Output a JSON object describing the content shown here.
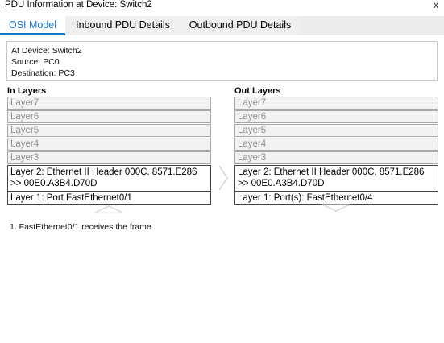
{
  "window": {
    "title": "PDU Information at Device: Switch2",
    "close_label": "x"
  },
  "tabs": [
    {
      "label": "OSI Model",
      "active": true
    },
    {
      "label": "Inbound PDU Details",
      "active": false
    },
    {
      "label": "Outbound PDU Details",
      "active": false
    }
  ],
  "info": {
    "device": "At Device: Switch2",
    "source": "Source: PC0",
    "destination": "Destination: PC3"
  },
  "in_layers": {
    "header": "In Layers",
    "items": [
      "Layer7",
      "Layer6",
      "Layer5",
      "Layer4",
      "Layer3",
      "Layer 2: Ethernet II Header 000C. 8571.E286 >> 00E0.A3B4.D70D",
      "Layer 1: Port FastEthernet0/1"
    ]
  },
  "out_layers": {
    "header": "Out Layers",
    "items": [
      "Layer7",
      "Layer6",
      "Layer5",
      "Layer4",
      "Layer3",
      "Layer 2: Ethernet II Header 000C. 8571.E286 >> 00E0.A3B4.D70D",
      "Layer 1: Port(s): FastEthernet0/4"
    ]
  },
  "notes": [
    "1. FastEthernet0/1 receives the frame."
  ],
  "colors": {
    "accent": "#1979ca"
  }
}
